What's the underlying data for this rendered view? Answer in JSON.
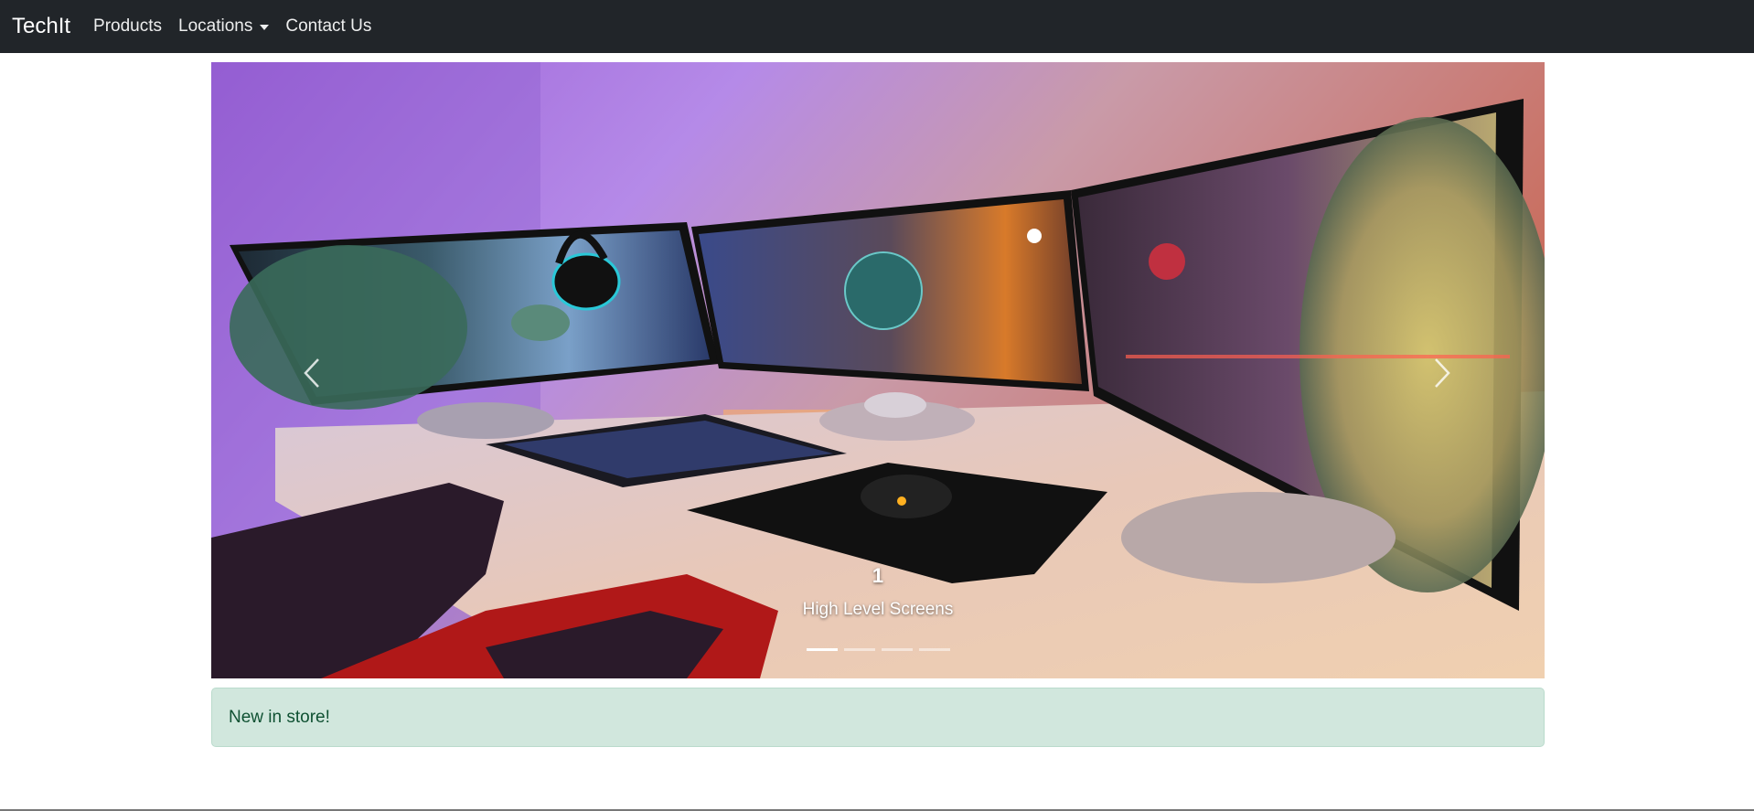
{
  "navbar": {
    "brand": "TechIt",
    "items": [
      {
        "label": "Products"
      },
      {
        "label": "Locations"
      },
      {
        "label": "Contact Us"
      }
    ]
  },
  "carousel": {
    "slide_title": "1",
    "slide_caption": "High Level Screens",
    "indicator_count": 4,
    "active_index": 0,
    "prev_icon": "chevron-left-icon",
    "next_icon": "chevron-right-icon"
  },
  "alert": {
    "text": "New in store!"
  },
  "colors": {
    "navbar_bg": "#212529",
    "alert_bg": "#d1e7dd",
    "alert_text": "#0f5132"
  }
}
